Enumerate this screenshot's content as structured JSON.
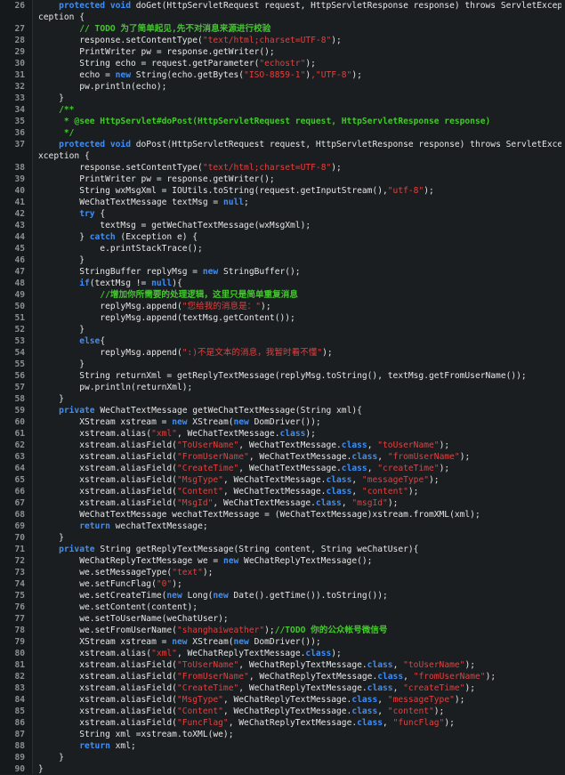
{
  "editor": {
    "lines": [
      {
        "n": "26",
        "t": [
          [
            "k",
            "    protected void "
          ],
          [
            "p",
            "doGet(HttpServletRequest request, HttpServletResponse response) throws ServletException, IOEx"
          ]
        ]
      },
      {
        "n": "",
        "t": [
          [
            "p",
            "ception {"
          ]
        ]
      },
      {
        "n": "27",
        "t": [
          [
            "p",
            "        "
          ],
          [
            "c",
            "// TODO 为了简单起见,先不对消息来源进行校验"
          ]
        ]
      },
      {
        "n": "28",
        "t": [
          [
            "p",
            "        response.setContentType("
          ],
          [
            "s",
            "\"text/html;charset=UTF-8\""
          ],
          [
            "p",
            ");"
          ]
        ]
      },
      {
        "n": "29",
        "t": [
          [
            "p",
            "        PrintWriter pw = response.getWriter();"
          ]
        ]
      },
      {
        "n": "30",
        "t": [
          [
            "p",
            "        String echo = request.getParameter("
          ],
          [
            "s",
            "\"echostr\""
          ],
          [
            "p",
            ");"
          ]
        ]
      },
      {
        "n": "31",
        "t": [
          [
            "p",
            "        echo = "
          ],
          [
            "k",
            "new"
          ],
          [
            "p",
            " String(echo.getBytes("
          ],
          [
            "s",
            "\"ISO-8859-1\""
          ],
          [
            "p",
            ")"
          ],
          [
            "s",
            ",\"UTF-8\""
          ],
          [
            "p",
            ");"
          ]
        ]
      },
      {
        "n": "32",
        "t": [
          [
            "p",
            "        pw.println(echo);"
          ]
        ]
      },
      {
        "n": "33",
        "t": [
          [
            "p",
            "    }"
          ]
        ]
      },
      {
        "n": "34",
        "t": [
          [
            "p",
            "    "
          ],
          [
            "c",
            "/**"
          ]
        ]
      },
      {
        "n": "35",
        "t": [
          [
            "c",
            "     * @see HttpServlet#doPost(HttpServletRequest request, HttpServletResponse response)"
          ]
        ]
      },
      {
        "n": "36",
        "t": [
          [
            "c",
            "     */"
          ]
        ]
      },
      {
        "n": "37",
        "t": [
          [
            "k",
            "    protected void "
          ],
          [
            "p",
            "doPost(HttpServletRequest request, HttpServletResponse response) throws ServletException, IOE"
          ]
        ]
      },
      {
        "n": "",
        "t": [
          [
            "p",
            "xception {"
          ]
        ]
      },
      {
        "n": "38",
        "t": [
          [
            "p",
            "        response.setContentType("
          ],
          [
            "s",
            "\"text/html;charset=UTF-8\""
          ],
          [
            "p",
            ");"
          ]
        ]
      },
      {
        "n": "39",
        "t": [
          [
            "p",
            "        PrintWriter pw = response.getWriter();"
          ]
        ]
      },
      {
        "n": "40",
        "t": [
          [
            "p",
            "        String wxMsgXml = IOUtils.toString(request.getInputStream(),"
          ],
          [
            "s",
            "\"utf-8\""
          ],
          [
            "p",
            ");"
          ]
        ]
      },
      {
        "n": "41",
        "t": [
          [
            "p",
            "        WeChatTextMessage textMsg = "
          ],
          [
            "k",
            "null"
          ],
          [
            "p",
            ";"
          ]
        ]
      },
      {
        "n": "42",
        "t": [
          [
            "p",
            "        "
          ],
          [
            "k",
            "try"
          ],
          [
            "p",
            " {"
          ]
        ]
      },
      {
        "n": "43",
        "t": [
          [
            "p",
            "            textMsg = getWeChatTextMessage(wxMsgXml);"
          ]
        ]
      },
      {
        "n": "44",
        "t": [
          [
            "p",
            "        } "
          ],
          [
            "k",
            "catch"
          ],
          [
            "p",
            " (Exception e) {"
          ]
        ]
      },
      {
        "n": "45",
        "t": [
          [
            "p",
            "            e.printStackTrace();"
          ]
        ]
      },
      {
        "n": "46",
        "t": [
          [
            "p",
            "        }"
          ]
        ]
      },
      {
        "n": "47",
        "t": [
          [
            "p",
            "        StringBuffer replyMsg = "
          ],
          [
            "k",
            "new"
          ],
          [
            "p",
            " StringBuffer();"
          ]
        ]
      },
      {
        "n": "48",
        "t": [
          [
            "p",
            "        "
          ],
          [
            "k",
            "if"
          ],
          [
            "p",
            "(textMsg != "
          ],
          [
            "k",
            "null"
          ],
          [
            "p",
            "){"
          ]
        ]
      },
      {
        "n": "49",
        "t": [
          [
            "p",
            "            "
          ],
          [
            "c",
            "//增加你所需要的处理逻辑，这里只是简单重复消息"
          ]
        ]
      },
      {
        "n": "50",
        "t": [
          [
            "p",
            "            replyMsg.append("
          ],
          [
            "s",
            "\"您给我的消息是：\""
          ],
          [
            "p",
            ");"
          ]
        ]
      },
      {
        "n": "51",
        "t": [
          [
            "p",
            "            replyMsg.append(textMsg.getContent());"
          ]
        ]
      },
      {
        "n": "52",
        "t": [
          [
            "p",
            "        }"
          ]
        ]
      },
      {
        "n": "53",
        "t": [
          [
            "p",
            "        "
          ],
          [
            "k",
            "else"
          ],
          [
            "p",
            "{"
          ]
        ]
      },
      {
        "n": "54",
        "t": [
          [
            "p",
            "            replyMsg.append("
          ],
          [
            "s",
            "\":)不是文本的消息，我暂时看不懂\""
          ],
          [
            "p",
            ");"
          ]
        ]
      },
      {
        "n": "55",
        "t": [
          [
            "p",
            "        }"
          ]
        ]
      },
      {
        "n": "56",
        "t": [
          [
            "p",
            "        String returnXml = getReplyTextMessage(replyMsg.toString(), textMsg.getFromUserName());"
          ]
        ]
      },
      {
        "n": "57",
        "t": [
          [
            "p",
            "        pw.println(returnXml);"
          ]
        ]
      },
      {
        "n": "58",
        "t": [
          [
            "p",
            "    }"
          ]
        ]
      },
      {
        "n": "59",
        "t": [
          [
            "k",
            "    private"
          ],
          [
            "p",
            " WeChatTextMessage getWeChatTextMessage(String xml){"
          ]
        ]
      },
      {
        "n": "60",
        "t": [
          [
            "p",
            "        XStream xstream = "
          ],
          [
            "k",
            "new"
          ],
          [
            "p",
            " XStream("
          ],
          [
            "k",
            "new"
          ],
          [
            "p",
            " DomDriver());"
          ]
        ]
      },
      {
        "n": "61",
        "t": [
          [
            "p",
            "        xstream.alias("
          ],
          [
            "s",
            "\"xml\""
          ],
          [
            "p",
            ", WeChatTextMessage."
          ],
          [
            "k",
            "class"
          ],
          [
            "p",
            ");"
          ]
        ]
      },
      {
        "n": "62",
        "t": [
          [
            "p",
            "        xstream.aliasField("
          ],
          [
            "s",
            "\"ToUserName\""
          ],
          [
            "p",
            ", WeChatTextMessage."
          ],
          [
            "k",
            "class"
          ],
          [
            "p",
            ", "
          ],
          [
            "s",
            "\"toUserName\""
          ],
          [
            "p",
            ");"
          ]
        ]
      },
      {
        "n": "63",
        "t": [
          [
            "p",
            "        xstream.aliasField("
          ],
          [
            "s",
            "\"FromUserName\""
          ],
          [
            "p",
            ", WeChatTextMessage."
          ],
          [
            "k",
            "class"
          ],
          [
            "p",
            ", "
          ],
          [
            "s",
            "\"fromUserName\""
          ],
          [
            "p",
            ");"
          ]
        ]
      },
      {
        "n": "64",
        "t": [
          [
            "p",
            "        xstream.aliasField("
          ],
          [
            "s",
            "\"CreateTime\""
          ],
          [
            "p",
            ", WeChatTextMessage."
          ],
          [
            "k",
            "class"
          ],
          [
            "p",
            ", "
          ],
          [
            "s",
            "\"createTime\""
          ],
          [
            "p",
            ");"
          ]
        ]
      },
      {
        "n": "65",
        "t": [
          [
            "p",
            "        xstream.aliasField("
          ],
          [
            "s",
            "\"MsgType\""
          ],
          [
            "p",
            ", WeChatTextMessage."
          ],
          [
            "k",
            "class"
          ],
          [
            "p",
            ", "
          ],
          [
            "s",
            "\"messageType\""
          ],
          [
            "p",
            ");"
          ]
        ]
      },
      {
        "n": "66",
        "t": [
          [
            "p",
            "        xstream.aliasField("
          ],
          [
            "s",
            "\"Content\""
          ],
          [
            "p",
            ", WeChatTextMessage."
          ],
          [
            "k",
            "class"
          ],
          [
            "p",
            ", "
          ],
          [
            "s",
            "\"content\""
          ],
          [
            "p",
            ");"
          ]
        ]
      },
      {
        "n": "67",
        "t": [
          [
            "p",
            "        xstream.aliasField("
          ],
          [
            "s",
            "\"MsgId\""
          ],
          [
            "p",
            ", WeChatTextMessage."
          ],
          [
            "k",
            "class"
          ],
          [
            "p",
            ", "
          ],
          [
            "s",
            "\"msgId\""
          ],
          [
            "p",
            ");"
          ]
        ]
      },
      {
        "n": "68",
        "t": [
          [
            "p",
            "        WeChatTextMessage wechatTextMessage = (WeChatTextMessage)xstream.fromXML(xml);"
          ]
        ]
      },
      {
        "n": "69",
        "t": [
          [
            "p",
            "        "
          ],
          [
            "k",
            "return"
          ],
          [
            "p",
            " wechatTextMessage;"
          ]
        ]
      },
      {
        "n": "70",
        "t": [
          [
            "p",
            "    }"
          ]
        ]
      },
      {
        "n": "71",
        "t": [
          [
            "k",
            "    private"
          ],
          [
            "p",
            " String getReplyTextMessage(String content, String weChatUser){"
          ]
        ]
      },
      {
        "n": "72",
        "t": [
          [
            "p",
            "        WeChatReplyTextMessage we = "
          ],
          [
            "k",
            "new"
          ],
          [
            "p",
            " WeChatReplyTextMessage();"
          ]
        ]
      },
      {
        "n": "73",
        "t": [
          [
            "p",
            "        we.setMessageType("
          ],
          [
            "s",
            "\"text\""
          ],
          [
            "p",
            ");"
          ]
        ]
      },
      {
        "n": "74",
        "t": [
          [
            "p",
            "        we.setFuncFlag("
          ],
          [
            "s",
            "\"0\""
          ],
          [
            "p",
            ");"
          ]
        ]
      },
      {
        "n": "75",
        "t": [
          [
            "p",
            "        we.setCreateTime("
          ],
          [
            "k",
            "new"
          ],
          [
            "p",
            " Long("
          ],
          [
            "k",
            "new"
          ],
          [
            "p",
            " Date().getTime()).toString());"
          ]
        ]
      },
      {
        "n": "76",
        "t": [
          [
            "p",
            "        we.setContent(content);"
          ]
        ]
      },
      {
        "n": "77",
        "t": [
          [
            "p",
            "        we.setToUserName(weChatUser);"
          ]
        ]
      },
      {
        "n": "78",
        "t": [
          [
            "p",
            "        we.setFromUserName("
          ],
          [
            "s",
            "\"shanghaiweather\""
          ],
          [
            "p",
            ");"
          ],
          [
            "c",
            "//TODO 你的公众帐号微信号"
          ]
        ]
      },
      {
        "n": "79",
        "t": [
          [
            "p",
            "        XStream xstream = "
          ],
          [
            "k",
            "new"
          ],
          [
            "p",
            " XStream("
          ],
          [
            "k",
            "new"
          ],
          [
            "p",
            " DomDriver());"
          ]
        ]
      },
      {
        "n": "80",
        "t": [
          [
            "p",
            "        xstream.alias("
          ],
          [
            "s",
            "\"xml\""
          ],
          [
            "p",
            ", WeChatReplyTextMessage."
          ],
          [
            "k",
            "class"
          ],
          [
            "p",
            ");"
          ]
        ]
      },
      {
        "n": "81",
        "t": [
          [
            "p",
            "        xstream.aliasField("
          ],
          [
            "s",
            "\"ToUserName\""
          ],
          [
            "p",
            ", WeChatReplyTextMessage."
          ],
          [
            "k",
            "class"
          ],
          [
            "p",
            ", "
          ],
          [
            "s",
            "\"toUserName\""
          ],
          [
            "p",
            ");"
          ]
        ]
      },
      {
        "n": "82",
        "t": [
          [
            "p",
            "        xstream.aliasField("
          ],
          [
            "s",
            "\"FromUserName\""
          ],
          [
            "p",
            ", WeChatReplyTextMessage."
          ],
          [
            "k",
            "class"
          ],
          [
            "p",
            ", "
          ],
          [
            "s",
            "\"fromUserName\""
          ],
          [
            "p",
            ");"
          ]
        ]
      },
      {
        "n": "83",
        "t": [
          [
            "p",
            "        xstream.aliasField("
          ],
          [
            "s",
            "\"CreateTime\""
          ],
          [
            "p",
            ", WeChatReplyTextMessage."
          ],
          [
            "k",
            "class"
          ],
          [
            "p",
            ", "
          ],
          [
            "s",
            "\"createTime\""
          ],
          [
            "p",
            ");"
          ]
        ]
      },
      {
        "n": "84",
        "t": [
          [
            "p",
            "        xstream.aliasField("
          ],
          [
            "s",
            "\"MsgType\""
          ],
          [
            "p",
            ", WeChatReplyTextMessage."
          ],
          [
            "k",
            "class"
          ],
          [
            "p",
            ", "
          ],
          [
            "s",
            "\"messageType\""
          ],
          [
            "p",
            ");"
          ]
        ]
      },
      {
        "n": "85",
        "t": [
          [
            "p",
            "        xstream.aliasField("
          ],
          [
            "s",
            "\"Content\""
          ],
          [
            "p",
            ", WeChatReplyTextMessage."
          ],
          [
            "k",
            "class"
          ],
          [
            "p",
            ", "
          ],
          [
            "s",
            "\"content\""
          ],
          [
            "p",
            ");"
          ]
        ]
      },
      {
        "n": "86",
        "t": [
          [
            "p",
            "        xstream.aliasField("
          ],
          [
            "s",
            "\"FuncFlag\""
          ],
          [
            "p",
            ", WeChatReplyTextMessage."
          ],
          [
            "k",
            "class"
          ],
          [
            "p",
            ", "
          ],
          [
            "s",
            "\"funcFlag\""
          ],
          [
            "p",
            ");"
          ]
        ]
      },
      {
        "n": "87",
        "t": [
          [
            "p",
            "        String xml =xstream.toXML(we);"
          ]
        ]
      },
      {
        "n": "88",
        "t": [
          [
            "p",
            "        "
          ],
          [
            "k",
            "return"
          ],
          [
            "p",
            " xml;"
          ]
        ]
      },
      {
        "n": "89",
        "t": [
          [
            "p",
            "    }"
          ]
        ]
      },
      {
        "n": "90",
        "t": [
          [
            "p",
            "}"
          ]
        ]
      }
    ]
  },
  "colors": {
    "background": "#1b1e20",
    "keyword": "#3f8ef5",
    "string": "#e0403f",
    "comment": "#44c62f",
    "text": "#e6e6e6",
    "line_number": "#8a8f93"
  }
}
